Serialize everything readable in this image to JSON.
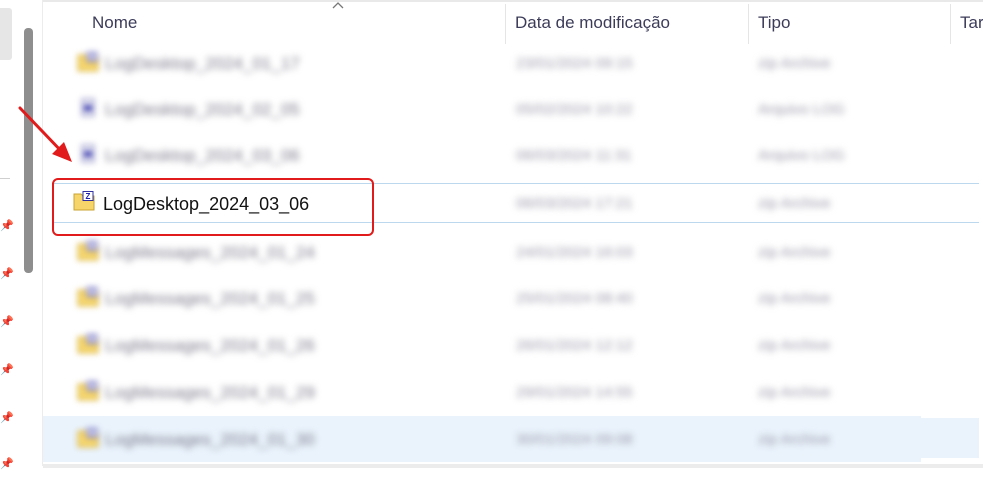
{
  "columns": {
    "name": "Nome",
    "date": "Data de modificação",
    "type": "Tipo",
    "size": "Tar"
  },
  "rows": [
    {
      "name": "LogDesktop_2024_01_17",
      "date": "23/01/2024 09:15",
      "type": "zip Archive",
      "blurred": true,
      "icon": "zip-folder-icon"
    },
    {
      "name": "LogDesktop_2024_02_05",
      "date": "05/02/2024 10:22",
      "type": "Arquivo LOG",
      "blurred": true,
      "icon": "log-file-icon"
    },
    {
      "name": "LogDesktop_2024_03_06",
      "date": "06/03/2024 11:31",
      "type": "Arquivo LOG",
      "blurred": true,
      "icon": "log-file-icon"
    },
    {
      "name": "LogDesktop_2024_03_06",
      "date": "06/03/2024 17:21",
      "type": "zip Archive",
      "blurred": false,
      "icon": "zip-folder-icon",
      "selected": true
    },
    {
      "name": "LogMessages_2024_01_24",
      "date": "24/01/2024 16:03",
      "type": "zip Archive",
      "blurred": true,
      "icon": "zip-folder-icon"
    },
    {
      "name": "LogMessages_2024_01_25",
      "date": "25/01/2024 08:40",
      "type": "zip Archive",
      "blurred": true,
      "icon": "zip-folder-icon"
    },
    {
      "name": "LogMessages_2024_01_26",
      "date": "26/01/2024 12:12",
      "type": "zip Archive",
      "blurred": true,
      "icon": "zip-folder-icon"
    },
    {
      "name": "LogMessages_2024_01_29",
      "date": "29/01/2024 14:55",
      "type": "zip Archive",
      "blurred": true,
      "icon": "zip-folder-icon"
    },
    {
      "name": "LogMessages_2024_01_30",
      "date": "30/01/2024 09:08",
      "type": "zip Archive",
      "blurred": true,
      "icon": "zip-folder-icon",
      "hover": true
    }
  ],
  "colors": {
    "highlight": "#e11b1b",
    "selection_border": "#bcd8ef",
    "hover_bg": "#eaf3fc",
    "header_text": "#3c3c5a"
  }
}
